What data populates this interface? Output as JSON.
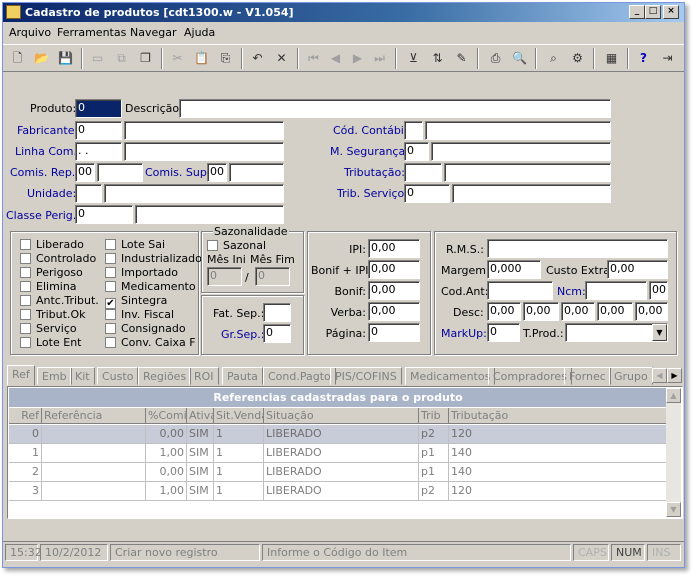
{
  "window": {
    "title": "Cadastro de produtos [cdt1300.w - V1.054]"
  },
  "menu": [
    "Arquivo",
    "Ferramentas",
    "Navegar",
    "Ajuda"
  ],
  "form": {
    "produto_label": "Produto:",
    "produto_value": "0",
    "descricao_label": "Descrição:",
    "descricao_value": "",
    "fabricante_label": "Fabricante:",
    "fabricante_value": "0",
    "linha_label": "Linha Com.:",
    "linha_value": " .  .",
    "comis_rep_label": "Comis. Rep.:",
    "comis_rep_value": "00",
    "comis_sup_label": "Comis. Sup.:",
    "comis_sup_value": "00",
    "unidade_label": "Unidade:",
    "classe_label": "Classe Perig.:",
    "classe_value": "0",
    "cod_contabil_label": "Cód. Contábil:",
    "seguranca_label": "M. Segurança:",
    "seguranca_value": "0",
    "tributacao_label": "Tributação:",
    "trib_servico_label": "Trib. Serviço:",
    "trib_servico_value": "0"
  },
  "checks_col1": [
    {
      "label": "Liberado",
      "checked": false
    },
    {
      "label": "Controlado",
      "checked": false
    },
    {
      "label": "Perigoso",
      "checked": false
    },
    {
      "label": "Elimina",
      "checked": false
    },
    {
      "label": "Antc.Tribut.",
      "checked": false
    },
    {
      "label": "Tribut.Ok",
      "checked": false
    },
    {
      "label": "Serviço",
      "checked": false
    },
    {
      "label": "Lote Ent",
      "checked": false
    }
  ],
  "checks_col2": [
    {
      "label": "Lote Sai",
      "checked": false
    },
    {
      "label": "Industrializado",
      "checked": false
    },
    {
      "label": "Importado",
      "checked": false
    },
    {
      "label": "Medicamento",
      "checked": false
    },
    {
      "label": "Sintegra",
      "checked": true
    },
    {
      "label": "Inv. Fiscal",
      "checked": false
    },
    {
      "label": "Consignado",
      "checked": false
    },
    {
      "label": "Conv. Caixa F",
      "checked": false
    }
  ],
  "sazonalidade": {
    "title": "Sazonalidade",
    "check_label": "Sazonal",
    "mes_ini_label": "Mês Ini",
    "mes_fim_label": "Mês Fim",
    "mes_ini_value": "0",
    "mes_fim_value": "0",
    "sep": "/"
  },
  "fat": {
    "fat_sep_label": "Fat. Sep.:",
    "gr_sep_label": "Gr.Sep.:",
    "gr_sep_value": "0"
  },
  "taxes": {
    "ipi_label": "IPI:",
    "ipi_value": "0,00",
    "bonif_ipi_label": "Bonif + IPI:",
    "bonif_ipi_value": "0,00",
    "bonif_label": "Bonif:",
    "bonif_value": "0,00",
    "verba_label": "Verba:",
    "verba_value": "0,00",
    "pagina_label": "Página:",
    "pagina_value": "0"
  },
  "pricing": {
    "rms_label": "R.M.S.:",
    "margem_label": "Margem:",
    "margem_value": "0,000",
    "custo_extra_label": "Custo Extra:",
    "custo_extra_value": "0,00",
    "cod_ant_label": "Cod.Ant:",
    "ncm_label": "Ncm:",
    "ncm_value": "00",
    "desc_label": "Desc:",
    "desc_values": [
      "0,00",
      "0,00",
      "0,00",
      "0,00",
      "0,00"
    ],
    "markup_label": "MarkUp:",
    "markup_value": "0",
    "tprod_label": "T.Prod.:",
    "tprod_value": ""
  },
  "tabs": [
    "Ref",
    "Emb",
    "Kit",
    "Custo",
    "Regiões",
    "ROI",
    "Pauta",
    "Cond.Pagto",
    "PIS/COFINS",
    "Medicamentos",
    "Compradores",
    "Fornec",
    "Grupo"
  ],
  "grid": {
    "title": "Referencias cadastradas para o produto",
    "headers": [
      "Ref",
      "Referência",
      "%Comis",
      "Ativa",
      "Sit.Venda",
      "Situação",
      "Trib",
      "Tributação"
    ],
    "rows": [
      [
        "0",
        "",
        "0,00",
        "SIM",
        "1",
        "LIBERADO",
        "p2",
        "120"
      ],
      [
        "1",
        "",
        "1,00",
        "SIM",
        "1",
        "LIBERADO",
        "p1",
        "140"
      ],
      [
        "2",
        "",
        "0,00",
        "SIM",
        "1",
        "LIBERADO",
        "p1",
        "140"
      ],
      [
        "3",
        "",
        "1,00",
        "SIM",
        "1",
        "LIBERADO",
        "p2",
        "120"
      ]
    ]
  },
  "status": {
    "time": "15:32",
    "date": "10/2/2012",
    "action": "Criar novo registro",
    "hint": "Informe o Código do Item",
    "caps": "CAPS",
    "num": "NUM",
    "ins": "INS"
  }
}
